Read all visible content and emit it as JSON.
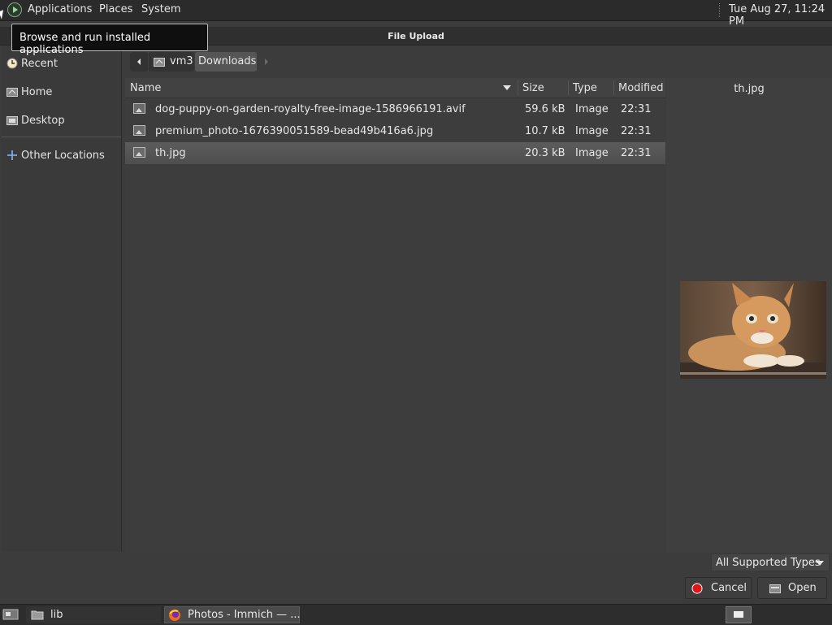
{
  "top_panel": {
    "menus": [
      "Applications",
      "Places",
      "System"
    ],
    "clock": "Tue Aug 27, 11:24 PM"
  },
  "tooltip": {
    "text": "Browse and run installed applications"
  },
  "dialog": {
    "title": "File Upload"
  },
  "sidebar": {
    "items": [
      {
        "label": "Recent",
        "icon": "clock-icon"
      },
      {
        "label": "Home",
        "icon": "home-folder-icon"
      },
      {
        "label": "Desktop",
        "icon": "desktop-folder-icon"
      },
      {
        "label": "Other Locations",
        "icon": "plus-icon"
      }
    ]
  },
  "pathbar": {
    "segments": [
      "vm3",
      "Downloads"
    ]
  },
  "file_list": {
    "columns": [
      "Name",
      "Size",
      "Type",
      "Modified"
    ],
    "rows": [
      {
        "name": "dog-puppy-on-garden-royalty-free-image-1586966191.avif",
        "size": "59.6 kB",
        "type": "Image",
        "modified": "22:31"
      },
      {
        "name": "premium_photo-1676390051589-bead49b416a6.jpg",
        "size": "10.7 kB",
        "type": "Image",
        "modified": "22:31"
      },
      {
        "name": "th.jpg",
        "size": "20.3 kB",
        "type": "Image",
        "modified": "22:31"
      }
    ],
    "selected_index": 2
  },
  "preview": {
    "title": "th.jpg"
  },
  "filter": {
    "selected": "All Supported Types"
  },
  "buttons": {
    "cancel": "Cancel",
    "open": "Open"
  },
  "taskbar": {
    "tasks": [
      "lib",
      "Photos - Immich — ..."
    ]
  }
}
